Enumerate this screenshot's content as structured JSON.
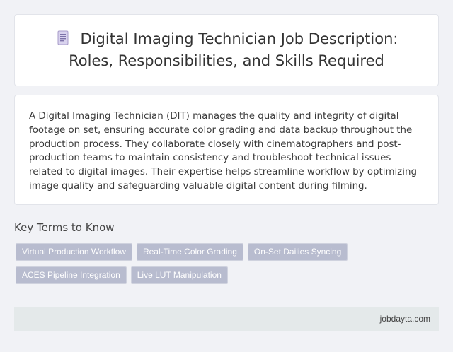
{
  "header": {
    "icon": "document-icon",
    "title": "Digital Imaging Technician Job Description: Roles, Responsibilities, and Skills Required"
  },
  "summary": {
    "text": "A Digital Imaging Technician (DIT) manages the quality and integrity of digital footage on set, ensuring accurate color grading and data backup throughout the production process. They collaborate closely with cinematographers and post-production teams to maintain consistency and troubleshoot technical issues related to digital images. Their expertise helps streamline workflow by optimizing image quality and safeguarding valuable digital content during filming."
  },
  "key_terms": {
    "heading": "Key Terms to Know",
    "tags": [
      "Virtual Production Workflow",
      "Real-Time Color Grading",
      "On-Set Dailies Syncing",
      "ACES Pipeline Integration",
      "Live LUT Manipulation"
    ]
  },
  "footer": {
    "site": "jobdayta.com"
  },
  "colors": {
    "page_bg": "#f1f2f6",
    "tag_bg": "#b8bccf",
    "footer_bg": "#e4e9ea"
  }
}
